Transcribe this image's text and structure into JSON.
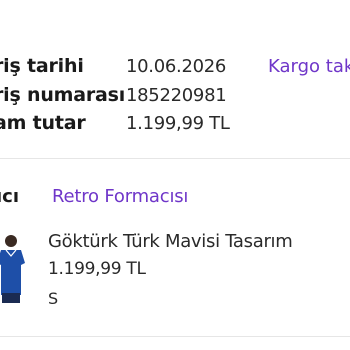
{
  "order_info": {
    "date_label": "riş tarihi",
    "date_value": "10.06.2026",
    "number_label": "riş numarası",
    "number_value": "185220981",
    "total_label": "am tutar",
    "total_value": "1.199,99 TL",
    "cargo_link": "Kargo tak"
  },
  "seller": {
    "label": "ıcı",
    "name": "Retro Formacısı"
  },
  "product": {
    "image_icon": "jersey-image",
    "name": "Göktürk Türk Mavisi Tasarım",
    "price": "1.199,99 TL",
    "size": "S"
  },
  "colors": {
    "accent": "#6f36c9",
    "jersey": "#1e4fa8",
    "divider": "#e6e6e6"
  }
}
